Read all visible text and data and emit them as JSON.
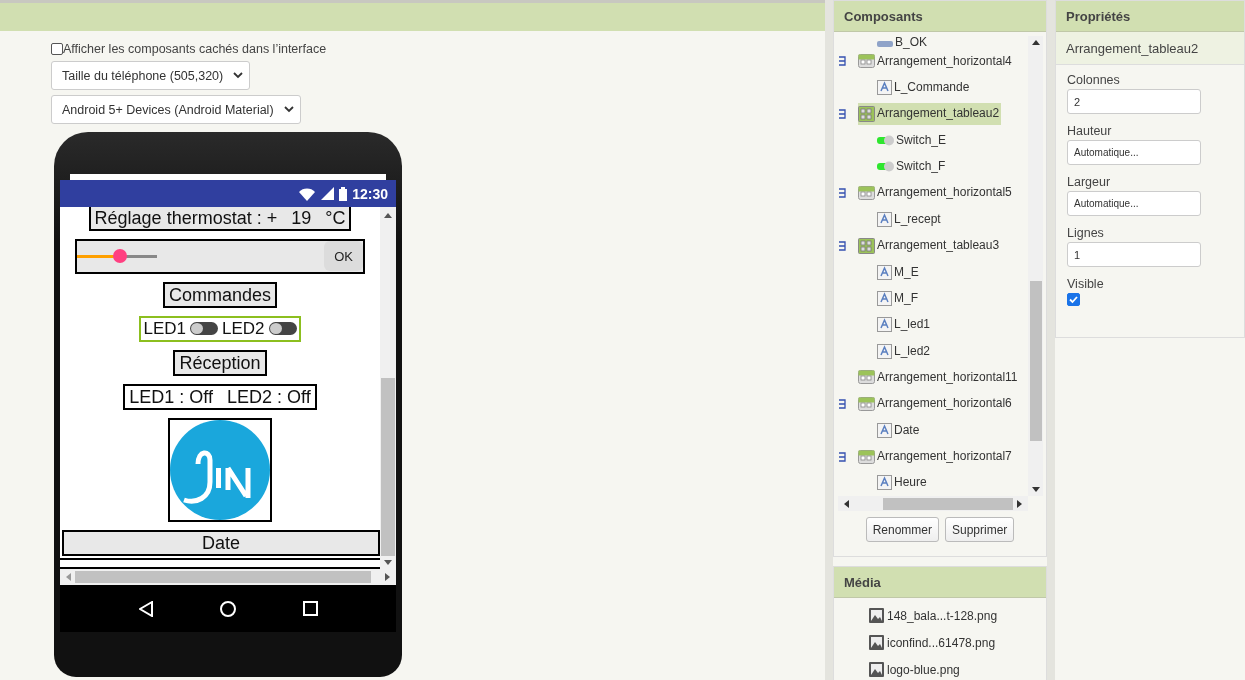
{
  "viewer": {
    "hidden_checkbox": {
      "label": "Afficher les composants cachés dans l’interface",
      "checked": false
    },
    "size_select": {
      "value": "Taille du téléphone (505,320)"
    },
    "theme_select": {
      "value": "Android 5+ Devices (Android Material)"
    }
  },
  "phone": {
    "status_time": "12:30",
    "screen": [
      {
        "kind": "label_row",
        "selected": false,
        "texts": [
          "Réglage thermostat : +",
          "19",
          "°C"
        ]
      },
      {
        "kind": "slider_row",
        "selected": false,
        "level": 0.54,
        "button": "OK"
      },
      {
        "kind": "label",
        "selected": false,
        "text": "Commandes"
      },
      {
        "kind": "switch_row",
        "selected": true,
        "switches": [
          {
            "label": "LED1",
            "on": false
          },
          {
            "label": "LED2",
            "on": false
          }
        ]
      },
      {
        "kind": "label",
        "selected": false,
        "text": "Réception"
      },
      {
        "kind": "label_row",
        "selected": false,
        "texts": [
          "LED1 : Off",
          "LED2 : Off"
        ]
      },
      {
        "kind": "image",
        "selected": false
      },
      {
        "kind": "wide_label",
        "selected": false,
        "text": "Date"
      },
      {
        "kind": "wide_cut",
        "selected": false
      }
    ]
  },
  "components": {
    "title": "Composants",
    "tree": [
      {
        "kind": "button",
        "name": "B_OK",
        "selected": false
      },
      {
        "kind": "horizontal",
        "name": "Arrangement_horizontal4",
        "selected": false,
        "expanded": true,
        "children": [
          {
            "kind": "label",
            "name": "L_Commande",
            "selected": false
          }
        ]
      },
      {
        "kind": "table",
        "name": "Arrangement_tableau2",
        "selected": true,
        "expanded": true,
        "children": [
          {
            "kind": "switch",
            "name": "Switch_E",
            "selected": false
          },
          {
            "kind": "switch",
            "name": "Switch_F",
            "selected": false
          }
        ]
      },
      {
        "kind": "horizontal",
        "name": "Arrangement_horizontal5",
        "selected": false,
        "expanded": true,
        "children": [
          {
            "kind": "label",
            "name": "L_recept",
            "selected": false
          }
        ]
      },
      {
        "kind": "table",
        "name": "Arrangement_tableau3",
        "selected": false,
        "expanded": true,
        "children": [
          {
            "kind": "label",
            "name": "M_E",
            "selected": false
          },
          {
            "kind": "label",
            "name": "M_F",
            "selected": false
          },
          {
            "kind": "label",
            "name": "L_led1",
            "selected": false
          },
          {
            "kind": "label",
            "name": "L_led2",
            "selected": false
          }
        ]
      },
      {
        "kind": "horizontal",
        "name": "Arrangement_horizontal11",
        "selected": false
      },
      {
        "kind": "horizontal",
        "name": "Arrangement_horizontal6",
        "selected": false,
        "expanded": true,
        "children": [
          {
            "kind": "label",
            "name": "Date",
            "selected": false
          }
        ]
      },
      {
        "kind": "horizontal",
        "name": "Arrangement_horizontal7",
        "selected": false,
        "expanded": true,
        "children": [
          {
            "kind": "label",
            "name": "Heure",
            "selected": false
          }
        ]
      }
    ],
    "buttons": [
      "Renommer",
      "Supprimer"
    ]
  },
  "media": {
    "title": "Média",
    "files": [
      "148_bala...t-128.png",
      "iconfind...61478.png",
      "logo-blue.png"
    ]
  },
  "properties": {
    "title": "Propriétés",
    "component": "Arrangement_tableau2",
    "items": [
      {
        "kind": "text",
        "label": "Colonnes",
        "value": "2"
      },
      {
        "kind": "text",
        "label": "Hauteur",
        "value": "Automatique..."
      },
      {
        "kind": "text",
        "label": "Largeur",
        "value": "Automatique..."
      },
      {
        "kind": "text",
        "label": "Lignes",
        "value": "1"
      },
      {
        "kind": "checkbox",
        "label": "Visible",
        "checked": true
      }
    ]
  }
}
